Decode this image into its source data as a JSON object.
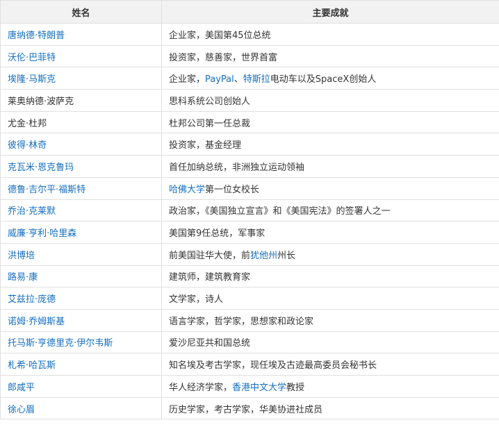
{
  "table": {
    "headers": [
      "姓名",
      "主要成就"
    ],
    "rows": [
      {
        "name": "唐纳德·特朗普",
        "name_link": true,
        "achievement": [
          {
            "t": "企业家，美国第45位总统"
          }
        ]
      },
      {
        "name": "沃伦·巴菲特",
        "name_link": true,
        "achievement": [
          {
            "t": "投资家，慈善家，世界首富"
          }
        ]
      },
      {
        "name": "埃隆·马斯克",
        "name_link": true,
        "achievement": [
          {
            "t": "企业家，"
          },
          {
            "t": "PayPal",
            "link": true
          },
          {
            "t": "、"
          },
          {
            "t": "特斯拉",
            "link": true
          },
          {
            "t": "电动车以及SpaceX创始人"
          }
        ]
      },
      {
        "name": "莱奥纳德·波萨克",
        "name_link": false,
        "achievement": [
          {
            "t": "思科系统公司创始人"
          }
        ]
      },
      {
        "name": "尤金·杜邦",
        "name_link": false,
        "achievement": [
          {
            "t": "杜邦公司第一任总裁"
          }
        ]
      },
      {
        "name": "彼得·林奇",
        "name_link": true,
        "achievement": [
          {
            "t": "投资家，基金经理"
          }
        ]
      },
      {
        "name": "克瓦米·恩克鲁玛",
        "name_link": true,
        "achievement": [
          {
            "t": "首任加纳总统，非洲独立运动领袖"
          }
        ]
      },
      {
        "name": "德鲁·吉尔平·福斯特",
        "name_link": true,
        "achievement": [
          {
            "t": "哈佛大学",
            "link": true
          },
          {
            "t": "第一位女校长"
          }
        ]
      },
      {
        "name": "乔治·克莱默",
        "name_link": true,
        "achievement": [
          {
            "t": "政治家，《美国独立宣言》和《美国宪法》的签署人之一"
          }
        ]
      },
      {
        "name": "威廉·亨利·哈里森",
        "name_link": true,
        "achievement": [
          {
            "t": "美国第9任总统，军事家"
          }
        ]
      },
      {
        "name": "洪博培",
        "name_link": true,
        "achievement": [
          {
            "t": "前美国驻华大使，前"
          },
          {
            "t": "犹他州",
            "link": true
          },
          {
            "t": "州长"
          }
        ]
      },
      {
        "name": "路易·康",
        "name_link": true,
        "achievement": [
          {
            "t": "建筑师，建筑教育家"
          }
        ]
      },
      {
        "name": "艾兹拉·庞德",
        "name_link": true,
        "achievement": [
          {
            "t": "文学家，诗人"
          }
        ]
      },
      {
        "name": "诺姆·乔姆斯基",
        "name_link": true,
        "achievement": [
          {
            "t": "语言学家，哲学家，思想家和政论家"
          }
        ]
      },
      {
        "name": "托马斯·亨德里克·伊尔韦斯",
        "name_link": true,
        "achievement": [
          {
            "t": "爱沙尼亚共和国总统"
          }
        ]
      },
      {
        "name": "札希·哈瓦斯",
        "name_link": true,
        "achievement": [
          {
            "t": "知名埃及考古学家，现任埃及古迹最高委员会秘书长"
          }
        ]
      },
      {
        "name": "郎咸平",
        "name_link": true,
        "achievement": [
          {
            "t": "华人经济学家，"
          },
          {
            "t": "香港中文大学",
            "link": true
          },
          {
            "t": "教授"
          }
        ]
      },
      {
        "name": "徐心眉",
        "name_link": true,
        "achievement": [
          {
            "t": "历史学家，考古学家，华美协进社成员"
          }
        ]
      }
    ]
  },
  "colors": {
    "link": "#136ec2",
    "text": "#333333",
    "header_bg": "#f2f2f2",
    "border": "#e0e0e0"
  }
}
